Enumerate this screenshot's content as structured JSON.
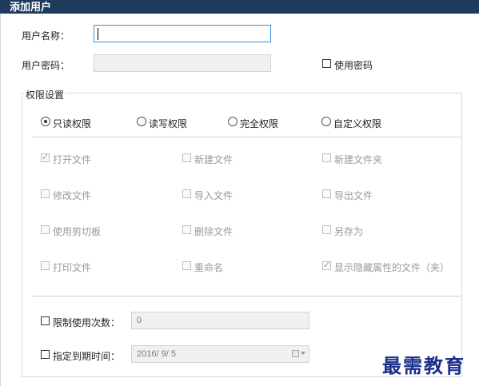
{
  "window": {
    "title": "添加用户"
  },
  "form": {
    "username_label": "用户名称：",
    "username_value": "",
    "password_label": "用户密码：",
    "use_password_label": "使用密码"
  },
  "permissions": {
    "group_title": "权限设置",
    "modes": [
      {
        "label": "只读权限",
        "selected": true
      },
      {
        "label": "读写权限",
        "selected": false
      },
      {
        "label": "完全权限",
        "selected": false
      },
      {
        "label": "自定义权限",
        "selected": false
      }
    ],
    "options": [
      {
        "label": "打开文件",
        "checked": true
      },
      {
        "label": "新建文件",
        "checked": false
      },
      {
        "label": "新建文件夹",
        "checked": false
      },
      {
        "label": "修改文件",
        "checked": false
      },
      {
        "label": "导入文件",
        "checked": false
      },
      {
        "label": "导出文件",
        "checked": false
      },
      {
        "label": "使用剪切板",
        "checked": false
      },
      {
        "label": "删除文件",
        "checked": false
      },
      {
        "label": "另存为",
        "checked": false
      },
      {
        "label": "打印文件",
        "checked": false
      },
      {
        "label": "重命名",
        "checked": false
      },
      {
        "label": "显示隐藏属性的文件（夹）",
        "checked": true
      }
    ]
  },
  "limits": {
    "usage_count_label": "限制使用次数：",
    "usage_count_value": "0",
    "expiry_label": "指定到期时间：",
    "expiry_value": "2016/ 9/ 5"
  },
  "watermark": {
    "text": "最需教育"
  },
  "colors": {
    "titlebar": "#1e3a5c",
    "focus_border": "#3b8fd8",
    "watermark": "#1a2f8a"
  }
}
